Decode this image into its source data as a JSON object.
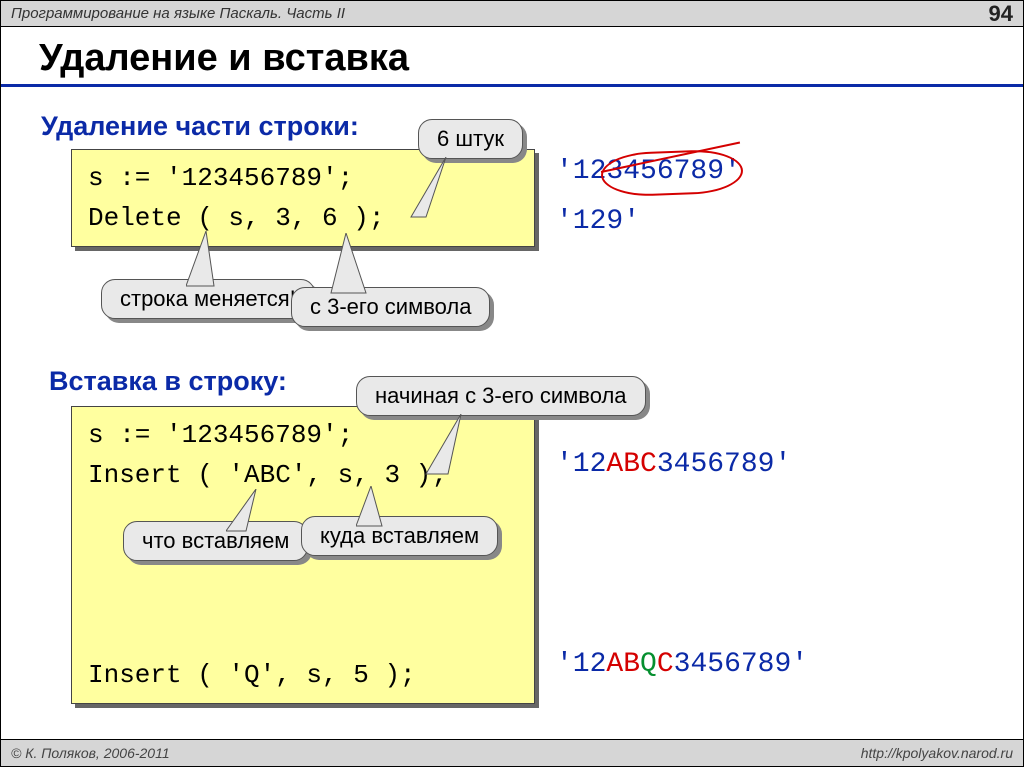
{
  "top": {
    "title": "Программирование на языке Паскаль. Часть II",
    "page": "94"
  },
  "heading": "Удаление и вставка",
  "section1": {
    "title": "Удаление части строки:",
    "code": "s := '123456789';\nDelete ( s, 3, 6 );",
    "callout_count": "6 штук",
    "callout_change": "строка\nменяется!",
    "callout_from3": "с 3-его символа",
    "res1": "'123456789'",
    "res2": "'129'"
  },
  "section2": {
    "title": "Вставка в строку:",
    "code": "s := '123456789';\nInsert ( 'ABC', s, 3 );\n\n\n\n\nInsert ( 'Q', s, 5 );",
    "callout_start3": "начиная с 3-его символа",
    "callout_what": "что\nвставляем",
    "callout_where": "куда\nвставляем",
    "res1_pre": "'12",
    "res1_mid": "ABC",
    "res1_post": "3456789'",
    "res2_pre": "'12",
    "res2_ab": "AB",
    "res2_q": "Q",
    "res2_c": "C",
    "res2_post": "3456789'"
  },
  "footer": {
    "left": "© К. Поляков, 2006-2011",
    "right": "http://kpolyakov.narod.ru"
  }
}
